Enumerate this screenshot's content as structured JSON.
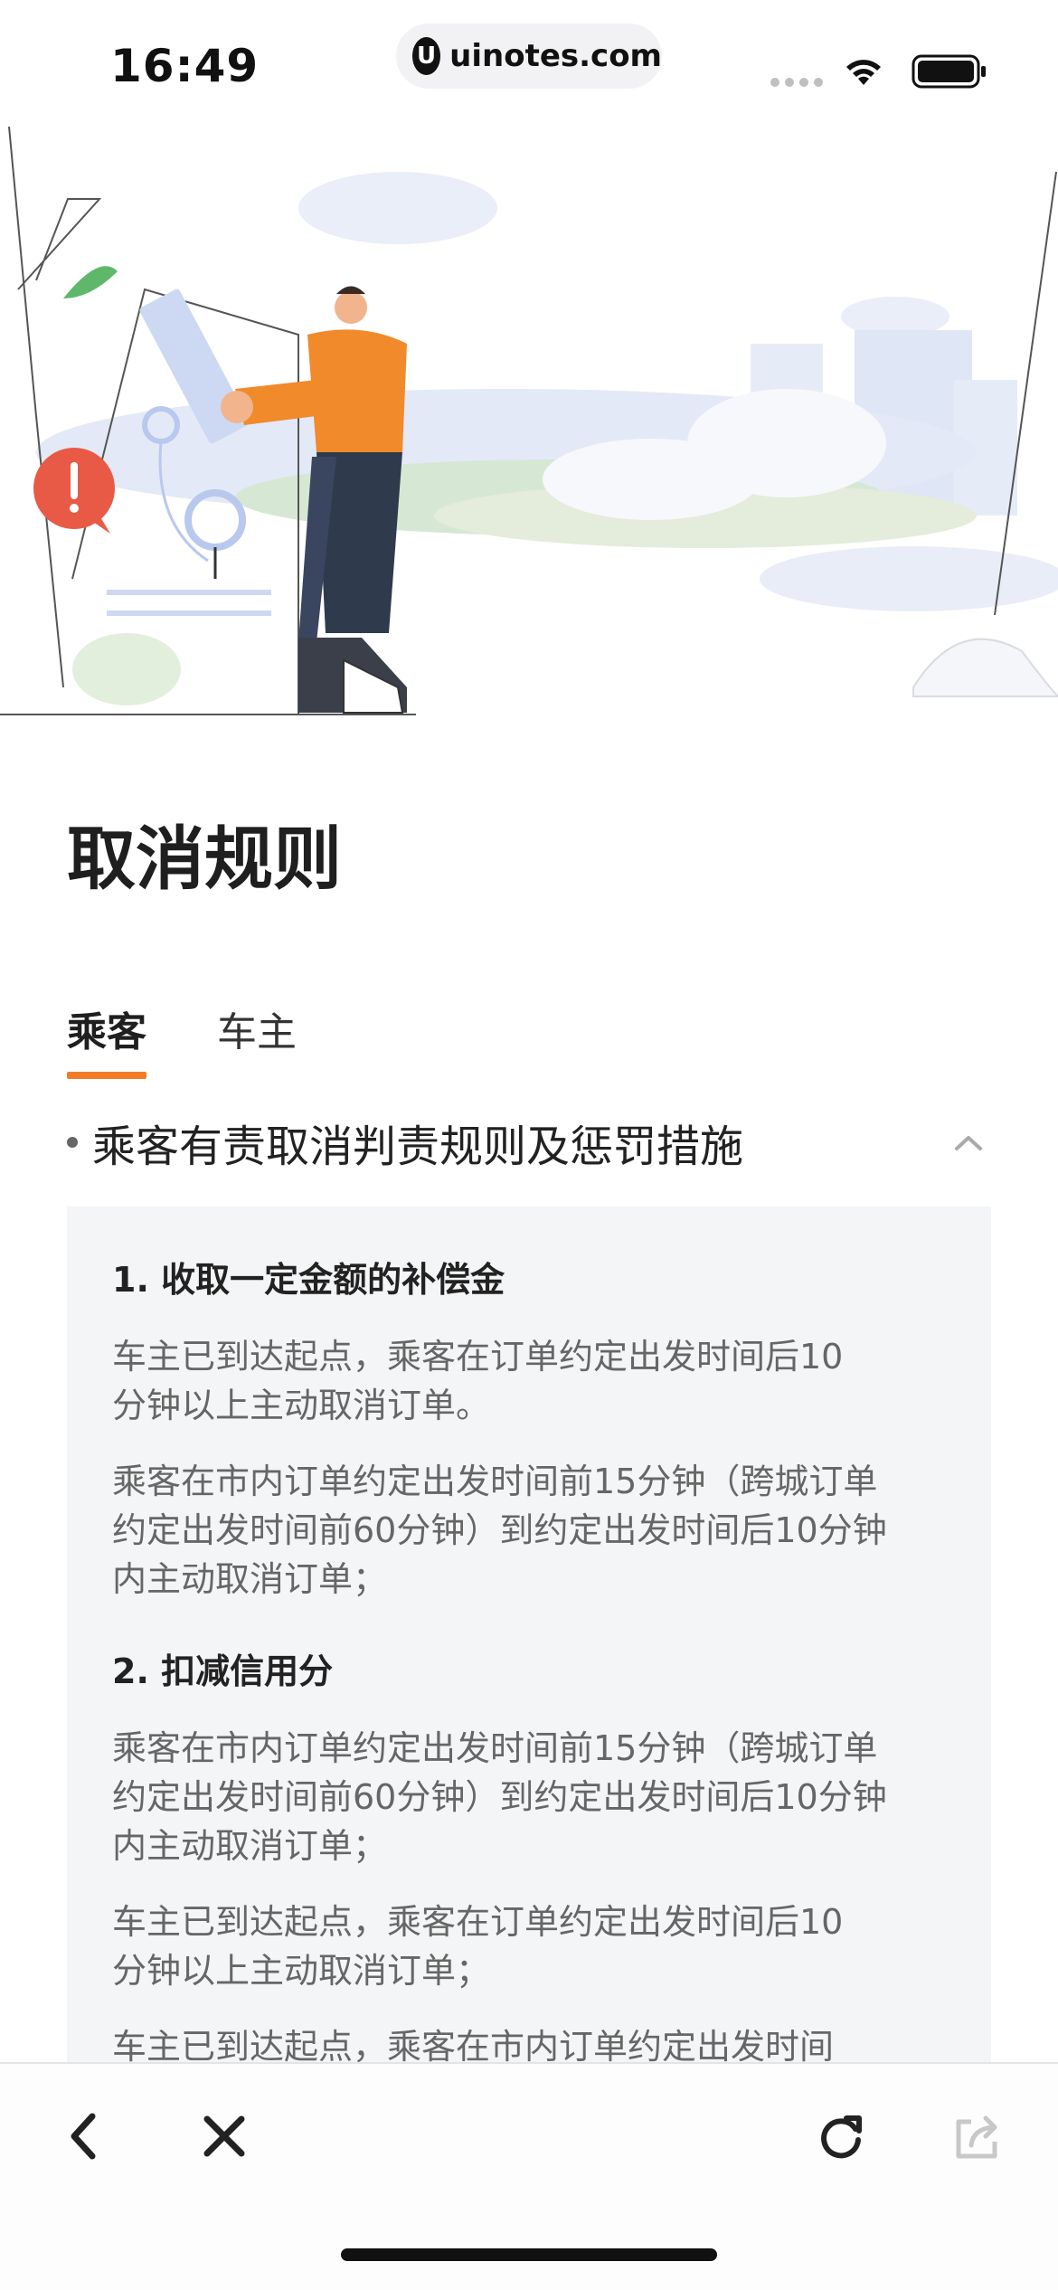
{
  "status_bar": {
    "time": "16:49",
    "url": "uinotes.com",
    "url_logo": "U",
    "icons": [
      "signal-icon",
      "wifi-icon",
      "battery-icon"
    ]
  },
  "page": {
    "title": "取消规则",
    "tabs": [
      {
        "label": "乘客",
        "active": true
      },
      {
        "label": "车主",
        "active": false
      }
    ],
    "section_title": "乘客有责取消判责规则及惩罚措施"
  },
  "rules": {
    "heading_1": "1. 收取一定金额的补偿金",
    "h1_p1_l1": "车主已到达起点，乘客在订单约定出发时间后10",
    "h1_p1_l2": "分钟以上主动取消订单。",
    "h1_p2_l1": "乘客在市内订单约定出发时间前15分钟（跨城订单",
    "h1_p2_l2": "约定出发时间前60分钟）到约定出发时间后10分钟",
    "h1_p2_l3": "内主动取消订单；",
    "heading_2": "2. 扣减信用分",
    "h2_p1_l1": "乘客在市内订单约定出发时间前15分钟（跨城订单",
    "h2_p1_l2": "约定出发时间前60分钟）到约定出发时间后10分钟",
    "h2_p1_l3": "内主动取消订单；",
    "h2_p2_l1": "车主已到达起点，乘客在订单约定出发时间后10",
    "h2_p2_l2": "分钟以上主动取消订单；",
    "h2_p3_l1": "车主已到达起点，乘客在市内订单约定出发时间"
  },
  "toolbar": {
    "icons": [
      "back-icon",
      "close-icon",
      "refresh-icon",
      "share-icon"
    ]
  },
  "colors": {
    "accent": "#f07c2a",
    "card_bg": "#f4f5f7",
    "muted_text": "#666666"
  }
}
